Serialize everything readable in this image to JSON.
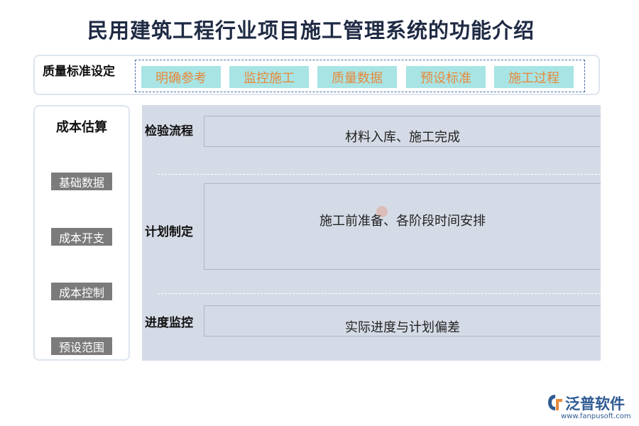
{
  "title": "民用建筑工程行业项目施工管理系统的功能介绍",
  "quality": {
    "label": "质量标准设定",
    "items": [
      "明确参考",
      "监控施工",
      "质量数据",
      "预设标准",
      "施工过程"
    ]
  },
  "cost": {
    "title": "成本估算",
    "items": [
      "基础数据",
      "成本开支",
      "成本控制",
      "预设范围"
    ]
  },
  "process": {
    "rows": [
      {
        "label": "检验流程",
        "content": "材料入库、施工完成"
      },
      {
        "label": "计划制定",
        "content": "施工前准备、各阶段时间安排"
      },
      {
        "label": "进度监控",
        "content": "实际进度与计划偏差"
      }
    ]
  },
  "logo": {
    "name": "泛普软件",
    "url": "www.fanpusoft.com",
    "icon": "fanpu-logo-icon"
  },
  "colors": {
    "tag_bg": "#a8e4e4",
    "tag_text": "#e7893c",
    "button_bg": "#7b7b7b",
    "panel_bg": "#d5dbe6",
    "brand": "#2f5a92"
  }
}
